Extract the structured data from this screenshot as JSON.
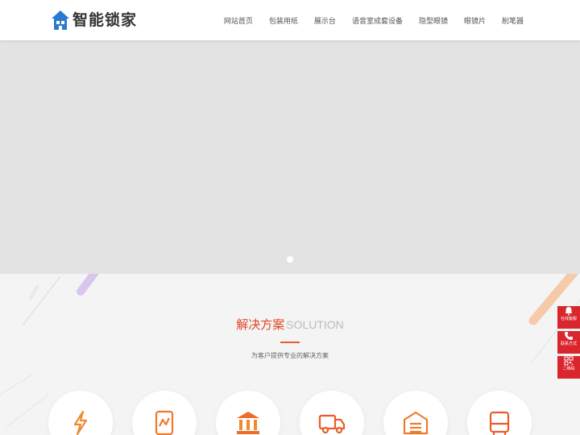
{
  "header": {
    "logo_text": "智能锁家",
    "nav": [
      "网站首页",
      "包装用纸",
      "展示台",
      "语音室成套设备",
      "隐型眼镜",
      "眼镜片",
      "削笔器"
    ]
  },
  "banner": {
    "slides_count": 1,
    "active_slide": 1
  },
  "solution": {
    "title_cn": "解决方案",
    "title_en": "SOLUTION",
    "subtitle": "为客户提供专业的解决方案",
    "icons": [
      "lightning-icon",
      "chart-tablet-icon",
      "bank-icon",
      "truck-icon",
      "warehouse-icon",
      "bus-icon"
    ]
  },
  "float_bar": {
    "items": [
      {
        "label": "在线客服",
        "icon": "customer-service-icon"
      },
      {
        "label": "联系方式",
        "icon": "phone-icon"
      },
      {
        "label": "二维码",
        "icon": "qrcode-icon"
      }
    ]
  },
  "colors": {
    "accent": "#e2451f",
    "float_bg": "#d9262c",
    "logo_blue": "#2a7ad0"
  }
}
